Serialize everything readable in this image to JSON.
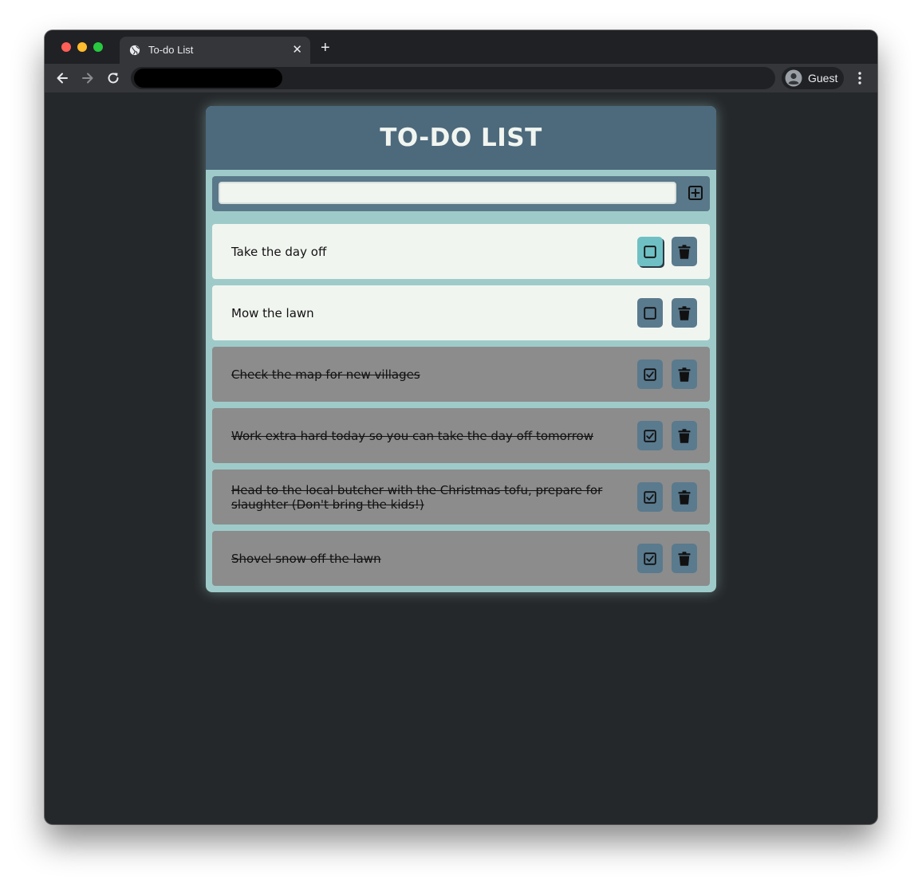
{
  "browser": {
    "tab_title": "To-do List",
    "tab_close": "✕",
    "new_tab": "+",
    "profile_label": "Guest"
  },
  "app": {
    "title": "TO-DO LIST",
    "input": {
      "value": "",
      "placeholder": ""
    },
    "colors": {
      "header": "#4d697c",
      "panel": "#9ecbc9",
      "item": "#f1f5f0",
      "item_completed": "#8c8c8c",
      "button": "#5a7a8e",
      "button_hover": "#6fc0c4"
    },
    "todos": [
      {
        "text": "Take the day off",
        "completed": false,
        "check_icon": "square-icon",
        "delete_icon": "trash-icon"
      },
      {
        "text": "Mow the lawn",
        "completed": false,
        "check_icon": "square-icon",
        "delete_icon": "trash-icon"
      },
      {
        "text": "Check the map for new villages",
        "completed": true,
        "check_icon": "check-square-icon",
        "delete_icon": "trash-icon"
      },
      {
        "text": "Work extra hard today so you can take the day off tomorrow",
        "completed": true,
        "check_icon": "check-square-icon",
        "delete_icon": "trash-icon"
      },
      {
        "text": "Head to the local butcher with the Christmas tofu, prepare for slaughter (Don't bring the kids!)",
        "completed": true,
        "check_icon": "check-square-icon",
        "delete_icon": "trash-icon"
      },
      {
        "text": "Shovel snow off the lawn",
        "completed": true,
        "check_icon": "check-square-icon",
        "delete_icon": "trash-icon"
      }
    ]
  }
}
